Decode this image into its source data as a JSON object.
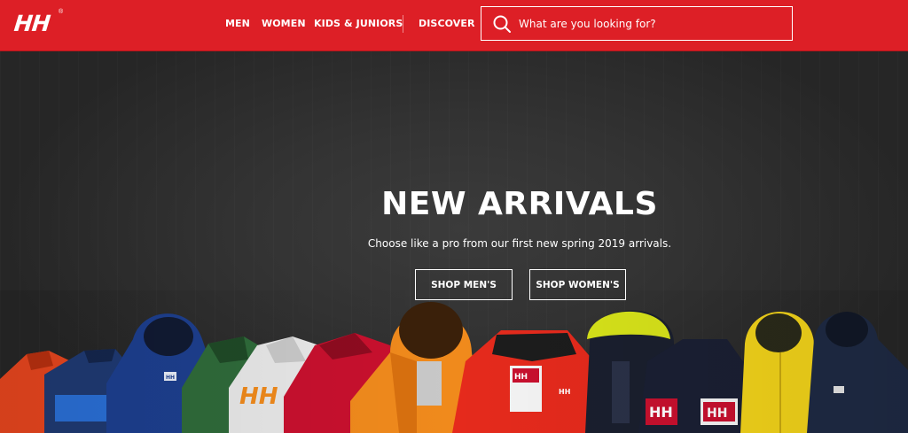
{
  "brand": {
    "logo_text": "HH",
    "registered": "®"
  },
  "nav": {
    "men": "MEN",
    "women": "WOMEN",
    "kids": "KIDS & JUNIORS",
    "discover": "DISCOVER"
  },
  "search": {
    "placeholder": "What are you looking for?",
    "value": ""
  },
  "hero": {
    "title": "NEW ARRIVALS",
    "subtitle": "Choose like a pro from our first new spring 2019 arrivals.",
    "shop_mens": "SHOP MEN'S",
    "shop_womens": "SHOP WOMEN'S"
  },
  "jacket_badge": "HH",
  "colors": {
    "header_red": "#dd1f26",
    "hero_bg": "#2b2b2b",
    "jacket_colors": [
      "#e8461e",
      "#1f3a73",
      "#1d3f8f",
      "#2f6b3a",
      "#e8e8e8",
      "#c8102e",
      "#f08a1c",
      "#e52a1c",
      "#d7e31a",
      "#1a1f2e",
      "#f2d31a",
      "#1e2a44"
    ]
  }
}
